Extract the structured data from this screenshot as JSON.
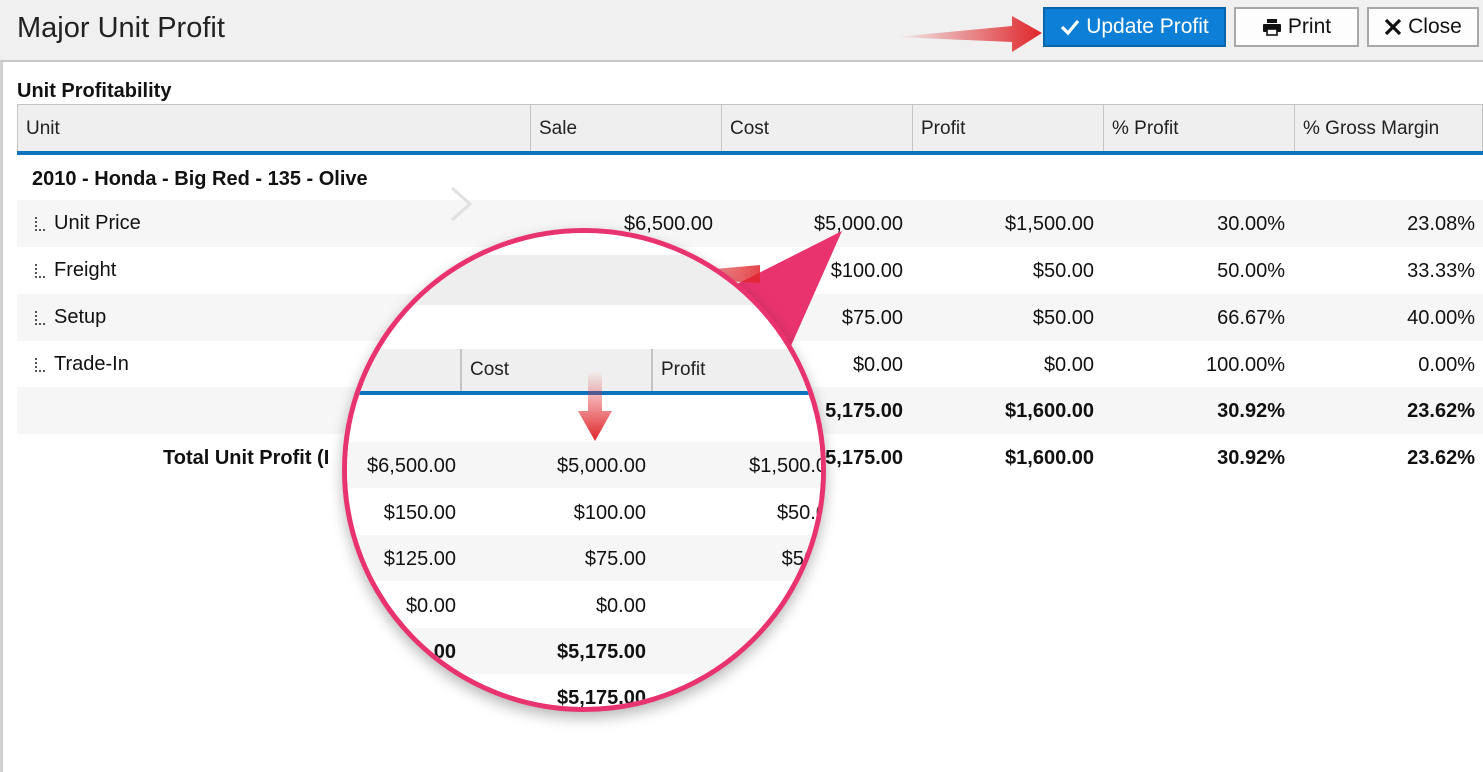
{
  "window": {
    "title": "Major Unit Profit"
  },
  "toolbar": {
    "update_label": "Update Profit",
    "print_label": "Print",
    "close_label": "Close"
  },
  "section_title": "Unit Profitability",
  "columns": [
    "Unit",
    "Sale",
    "Cost",
    "Profit",
    "% Profit",
    "% Gross Margin"
  ],
  "group": {
    "title": "2010 - Honda - Big Red - 135 - Olive"
  },
  "rows": [
    {
      "name": "Unit Price",
      "sale": "$6,500.00",
      "cost": "$5,000.00",
      "profit": "$1,500.00",
      "pct_profit": "30.00%",
      "gross_margin": "23.08%"
    },
    {
      "name": "Freight",
      "sale": "",
      "cost": "$100.00",
      "profit": "$50.00",
      "pct_profit": "50.00%",
      "gross_margin": "33.33%"
    },
    {
      "name": "Setup",
      "sale": "",
      "cost": "$75.00",
      "profit": "$50.00",
      "pct_profit": "66.67%",
      "gross_margin": "40.00%"
    },
    {
      "name": "Trade-In",
      "sale": "",
      "cost": "$0.00",
      "profit": "$0.00",
      "pct_profit": "100.00%",
      "gross_margin": "0.00%"
    }
  ],
  "subtotal": {
    "cost": "5,175.00",
    "profit": "$1,600.00",
    "pct_profit": "30.92%",
    "gross_margin": "23.62%"
  },
  "total": {
    "label": "Total Unit Profit (I",
    "cost": "5,175.00",
    "profit": "$1,600.00",
    "pct_profit": "30.92%",
    "gross_margin": "23.62%"
  },
  "zoom": {
    "headers": [
      "Cost",
      "Profit"
    ],
    "rows": [
      {
        "sale": "$6,500.00",
        "cost": "$5,000.00",
        "profit": "$1,500.0"
      },
      {
        "sale": "$150.00",
        "cost": "$100.00",
        "profit": "$50.0"
      },
      {
        "sale": "$125.00",
        "cost": "$75.00",
        "profit": "$50"
      },
      {
        "sale": "$0.00",
        "cost": "$0.00",
        "profit": ""
      },
      {
        "sale": ".00",
        "cost": "$5,175.00",
        "profit": "$"
      },
      {
        "sale": "",
        "cost": "$5,175.00",
        "profit": ""
      }
    ]
  },
  "colors": {
    "accent": "#0d7fd6",
    "header_line": "#0f72bd",
    "callout": "#e8336f",
    "arrow": "#e0262b"
  }
}
